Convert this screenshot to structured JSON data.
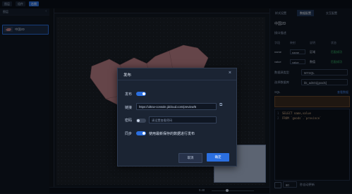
{
  "topbar": {
    "buttons": [
      "图层",
      "组件",
      "右侧"
    ]
  },
  "left_panel": {
    "title": "图层",
    "layer_label": "中国2D"
  },
  "right_panel": {
    "tabs": [
      "样式设置",
      "数据配置",
      "交互配置"
    ],
    "section_title": "中国2D",
    "sub_title": "接口描述",
    "mapping_headers": [
      "字段",
      "映射",
      "说明",
      "状态"
    ],
    "mapping_rows": [
      {
        "field": "name",
        "value": "name",
        "desc": "区域",
        "status": "匹配成功"
      },
      {
        "field": "value",
        "value": "value",
        "desc": "数值",
        "status": "匹配成功"
      }
    ],
    "data_source_type_label": "数据源类型",
    "data_source_type": "MYSQL",
    "data_source_label": "选择数据库",
    "data_source": "bk_ads01[goods]",
    "sql_label": "SQL",
    "sql_link": "查看数据",
    "sql_lines": [
      "SELECT name,value",
      "FROM `goods`.`province`"
    ],
    "refresh_value": "60",
    "refresh_label": "秒自动更新"
  },
  "bottom_bar": {
    "zoom": "0.40"
  },
  "modal": {
    "title": "发布",
    "publish_label": "发布",
    "link_label": "链接",
    "link_value": "https://ultrav-console.jdcloud.com/preview/5",
    "password_label": "密码",
    "password_placeholder": "请设置查看密码",
    "sync_label": "同步",
    "sync_text": "使用最新保存的数据进行发布",
    "cancel": "取消",
    "confirm": "确定"
  },
  "colors": {
    "accent": "#2b6fe0",
    "map_fill": "#b87f86",
    "panel_bg": "#1b2433"
  }
}
